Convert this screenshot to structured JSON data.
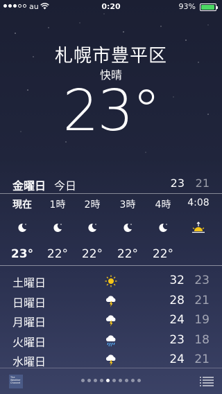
{
  "status": {
    "carrier": "au",
    "time": "0:20",
    "battery": "93%",
    "battery_level": 0.93,
    "signal_bars_filled": 3,
    "signal_bars_total": 5
  },
  "location": {
    "city": "札幌市豊平区",
    "condition": "快晴",
    "temperature": "23°"
  },
  "today": {
    "day": "金曜日",
    "label": "今日",
    "high": "23",
    "low": "21"
  },
  "hourly": [
    {
      "time": "現在",
      "icon": "moon-icon",
      "temp": "23°"
    },
    {
      "time": "1時",
      "icon": "moon-icon",
      "temp": "22°"
    },
    {
      "time": "2時",
      "icon": "moon-icon",
      "temp": "22°"
    },
    {
      "time": "3時",
      "icon": "moon-icon",
      "temp": "22°"
    },
    {
      "time": "4時",
      "icon": "moon-icon",
      "temp": "22°"
    },
    {
      "time": "4:08",
      "icon": "sunrise-icon",
      "temp": ""
    }
  ],
  "daily": [
    {
      "day": "土曜日",
      "icon": "sun-icon",
      "high": "32",
      "low": "23"
    },
    {
      "day": "日曜日",
      "icon": "thunderstorm-icon",
      "high": "28",
      "low": "21"
    },
    {
      "day": "月曜日",
      "icon": "thunderstorm-icon",
      "high": "24",
      "low": "19"
    },
    {
      "day": "火曜日",
      "icon": "rain-icon",
      "high": "23",
      "low": "18"
    },
    {
      "day": "水曜日",
      "icon": "thunderstorm-icon",
      "high": "24",
      "low": "21"
    }
  ],
  "bottom": {
    "logo_text": "The Weather Channel",
    "page_count": 10,
    "active_page": 4
  },
  "colors": {
    "sun": "#f5c518",
    "battery": "#4cd964",
    "lightning": "#f5c518",
    "rain": "#5ab4ff"
  }
}
